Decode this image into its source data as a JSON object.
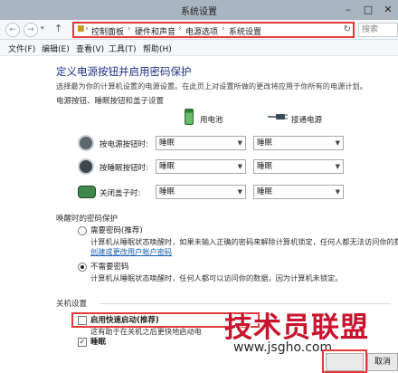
{
  "window": {
    "title": "系统设置"
  },
  "nav": {
    "back": "←",
    "forward": "→",
    "up": "↑"
  },
  "breadcrumb": [
    "控制面板",
    "硬件和声音",
    "电源选项",
    "系统设置"
  ],
  "search": {
    "placeholder": "搜索"
  },
  "menu": [
    "文件(F)",
    "编辑(E)",
    "查看(V)",
    "工具(T)",
    "帮助(H)"
  ],
  "page": {
    "heading": "定义电源按钮并启用密码保护",
    "description": "选择最为你的计算机设置的电源设置。在此页上对设置所做的更改将应用于你所有的电源计划。"
  },
  "power_section": {
    "title": "电源按钮、睡眠按钮和盖子设置",
    "col_battery": "用电池",
    "col_plugged": "接通电源",
    "rows": [
      {
        "label": "按电源按钮时:",
        "battery": "睡眠",
        "plugged": "睡眠",
        "icon": "power-icon"
      },
      {
        "label": "按睡眠按钮时:",
        "battery": "睡眠",
        "plugged": "睡眠",
        "icon": "sleep-icon"
      },
      {
        "label": "关闭盖子时:",
        "battery": "睡眠",
        "plugged": "睡眠",
        "icon": "laptop-lid-icon"
      }
    ]
  },
  "password_section": {
    "title": "唤醒时的密码保护",
    "opt1_label": "需要密码(推荐)",
    "opt1_text": "计算机从睡眠状态唤醒时，如果未输入正确的密码来解除计算机锁定，任何人都无法访问你的数",
    "opt1_link": "创建或更改用户帐户密码",
    "opt2_label": "不需要密码",
    "opt2_text": "计算机从睡眠状态唤醒时，任何人都可以访问你的数据，因为计算机未锁定。"
  },
  "shutdown_section": {
    "title": "关机设置",
    "fast_startup_label": "启用快速启动(推荐)",
    "fast_startup_text": "这有助于在关机之后更快地启动电",
    "sleep_label": "睡眠"
  },
  "footer": {
    "cancel": "取消"
  },
  "watermark": {
    "text": "技术员联盟",
    "url": "www.jsgho.com"
  },
  "colors": {
    "highlight": "#e43a3a",
    "heading": "#1e3287",
    "link": "#1a5fb4"
  }
}
